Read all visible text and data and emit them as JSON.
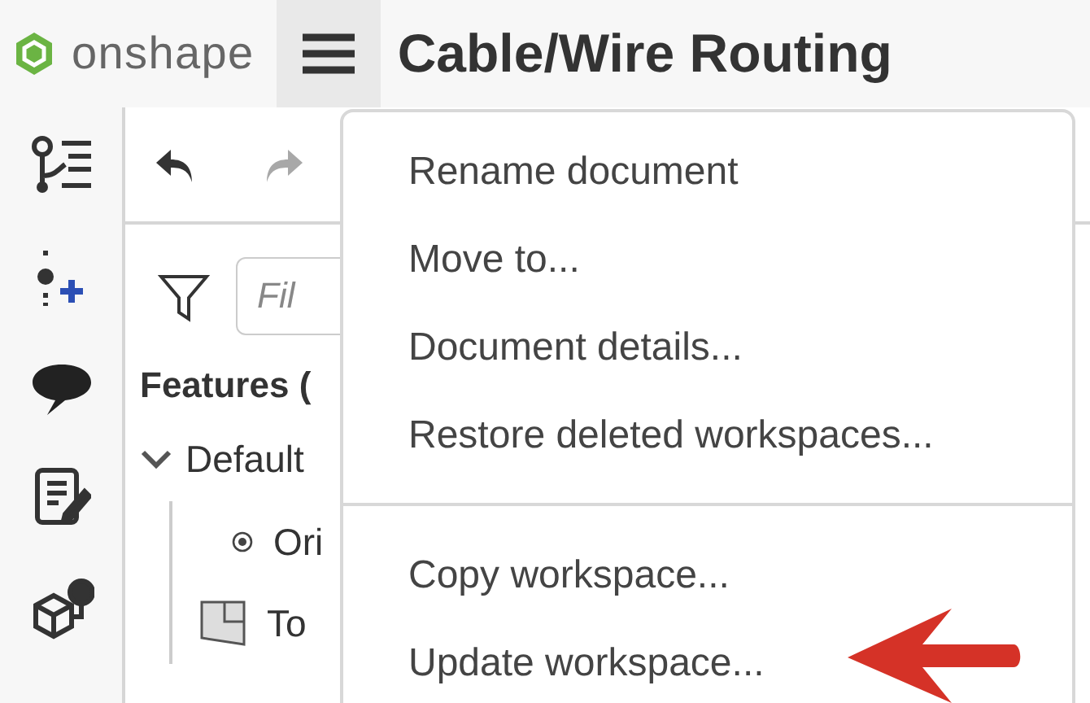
{
  "header": {
    "logo_text": "onshape",
    "title": "Cable/Wire Routing"
  },
  "toolbar": [
    {
      "kind": "undo",
      "disabled": false
    },
    {
      "kind": "redo",
      "disabled": true
    }
  ],
  "filter": {
    "placeholder": "Fil"
  },
  "features": {
    "heading": "Features (",
    "tree": [
      {
        "label": "Default",
        "expanded": true,
        "children": [
          {
            "label": "Ori",
            "kind": "origin"
          },
          {
            "label": "To",
            "kind": "plane"
          }
        ]
      }
    ]
  },
  "menu": {
    "groups": [
      [
        "Rename document",
        "Move to...",
        "Document details...",
        "Restore deleted workspaces..."
      ],
      [
        "Copy workspace...",
        "Update workspace..."
      ]
    ]
  }
}
